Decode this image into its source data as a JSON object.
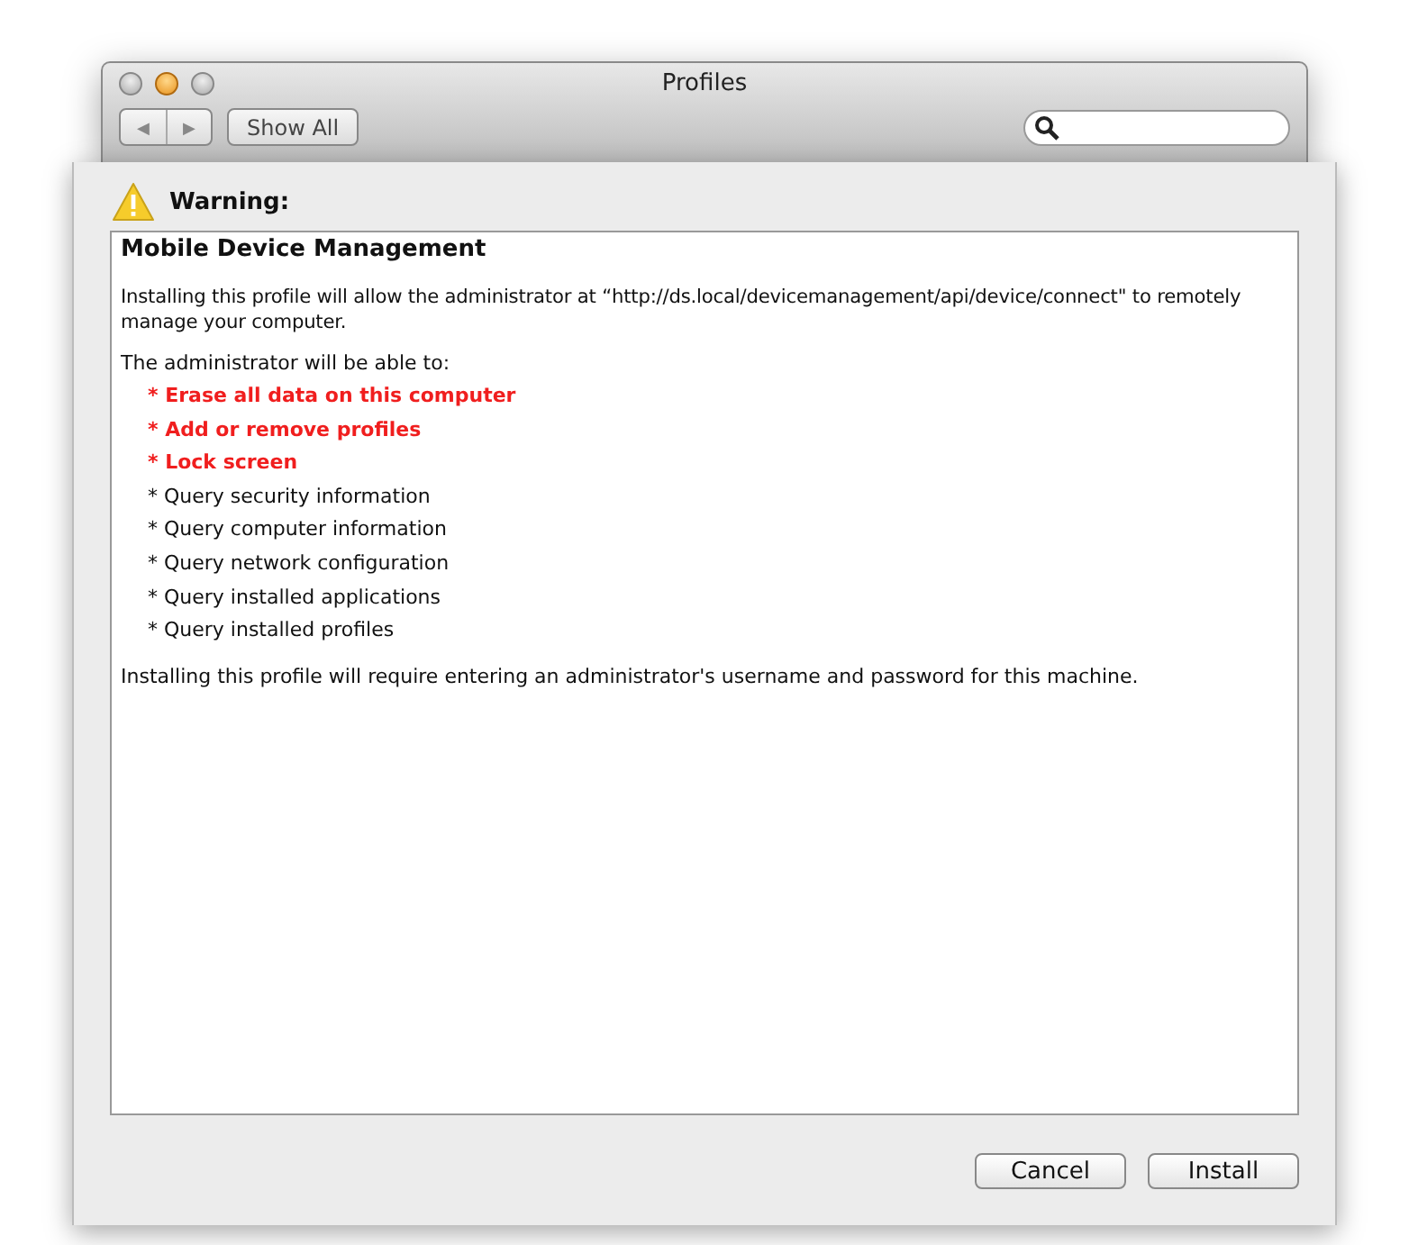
{
  "window": {
    "title": "Profiles"
  },
  "toolbar": {
    "back": "◀",
    "forward": "▶",
    "show_all": "Show All"
  },
  "sheet": {
    "heading": "Warning:",
    "title": "Mobile Device Management",
    "intro": "Installing this profile will allow the administrator at “http://ds.local/devicemanagement/api/device/connect\" to remotely manage your computer.",
    "abilities_label": "The administrator will be able to:",
    "abilities": [
      {
        "text": "* Erase all data on this computer",
        "kind": "critical"
      },
      {
        "text": "* Add or remove profiles",
        "kind": "critical"
      },
      {
        "text": "* Lock screen",
        "kind": "critical"
      },
      {
        "text": "* Query security information",
        "kind": "normal"
      },
      {
        "text": "* Query computer information",
        "kind": "normal"
      },
      {
        "text": "* Query network configuration",
        "kind": "normal"
      },
      {
        "text": "* Query installed applications",
        "kind": "normal"
      },
      {
        "text": "* Query installed profiles",
        "kind": "normal"
      }
    ],
    "footer": "Installing this profile will require entering an administrator's username and password for this machine.",
    "buttons": [
      "Cancel",
      "Install"
    ]
  }
}
